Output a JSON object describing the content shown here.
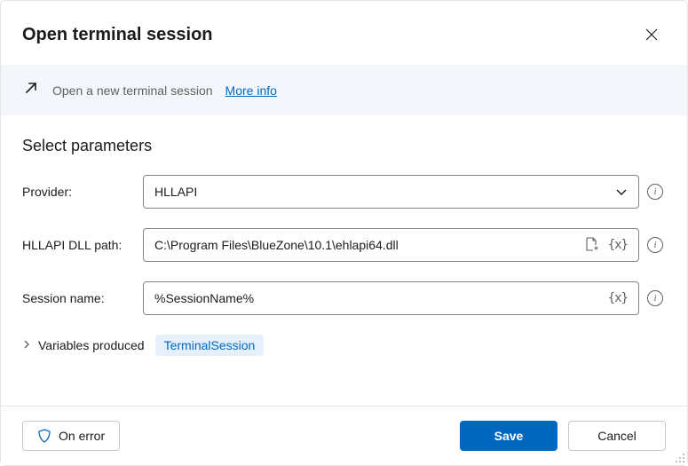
{
  "header": {
    "title": "Open terminal session"
  },
  "banner": {
    "text": "Open a new terminal session",
    "link": "More info"
  },
  "section": {
    "title": "Select parameters"
  },
  "fields": {
    "provider": {
      "label": "Provider:",
      "value": "HLLAPI"
    },
    "dllPath": {
      "label": "HLLAPI DLL path:",
      "value": "C:\\Program Files\\BlueZone\\10.1\\ehlapi64.dll"
    },
    "sessionName": {
      "label": "Session name:",
      "value": "%SessionName%"
    }
  },
  "variables": {
    "label": "Variables produced",
    "chip": "TerminalSession"
  },
  "footer": {
    "onError": "On error",
    "save": "Save",
    "cancel": "Cancel"
  }
}
